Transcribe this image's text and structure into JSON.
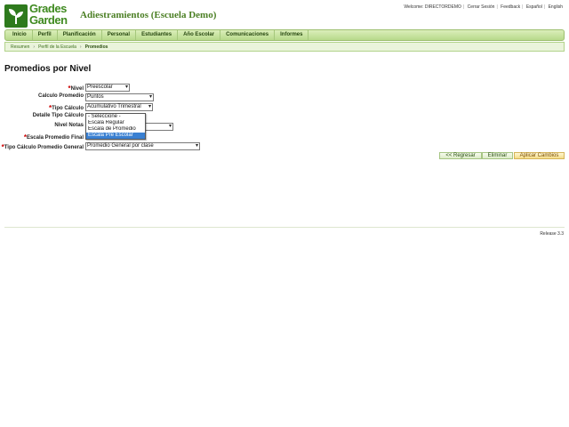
{
  "header": {
    "logo_line1": "Grades",
    "logo_line2": "Garden",
    "site_title": "Adiestramientos (Escuela Demo)",
    "toplinks": {
      "welcome": "Welcome: DIRECTORDEMO",
      "logout": "Cerrar Sesión",
      "feedback": "Feedback",
      "spanish": "Español",
      "english": "English"
    }
  },
  "nav": [
    "Inicio",
    "Perfil",
    "Planificación",
    "Personal",
    "Estudiantes",
    "Año Escolar",
    "Comunicaciones",
    "Informes"
  ],
  "breadcrumb": [
    "Resumen",
    "Perfil de la Escuela",
    "Promedios"
  ],
  "page_title": "Promedios por Nivel",
  "form": {
    "nivel": {
      "label": "Nivel",
      "value": "Preescolar"
    },
    "calculo_promedio": {
      "label": "Calculo Promedio",
      "value": "Puntos"
    },
    "tipo_calculo": {
      "label": "Tipo Cálculo",
      "value": "Acumulativo Trimestral"
    },
    "detalle_tipo_calculo": {
      "label": "Detalle Tipo Cálculo"
    },
    "nivel_notas": {
      "label": "Nivel Notas"
    },
    "escala_promedio_final": {
      "label": "Escala Promedio Final"
    },
    "tipo_calculo_promedio_general": {
      "label": "Tipo Cálculo Promedio General",
      "value": "Promedio General por clase"
    },
    "required_mark": "*"
  },
  "dropdown_options": [
    "- Seleccione -",
    "Escala Regular",
    "Escala de Promedio",
    "Escala Pre Escolar"
  ],
  "dropdown_selected_index": 3,
  "buttons": {
    "back": "<< Regresar",
    "delete": "Eliminar",
    "apply": "Aplicar Cambios"
  },
  "footer": {
    "release": "Release 3.3"
  },
  "colors": {
    "brand_green": "#3f8a20",
    "nav_bg": "#c7e3a0",
    "selection_blue": "#3a80d2",
    "required_red": "#cc0000"
  }
}
